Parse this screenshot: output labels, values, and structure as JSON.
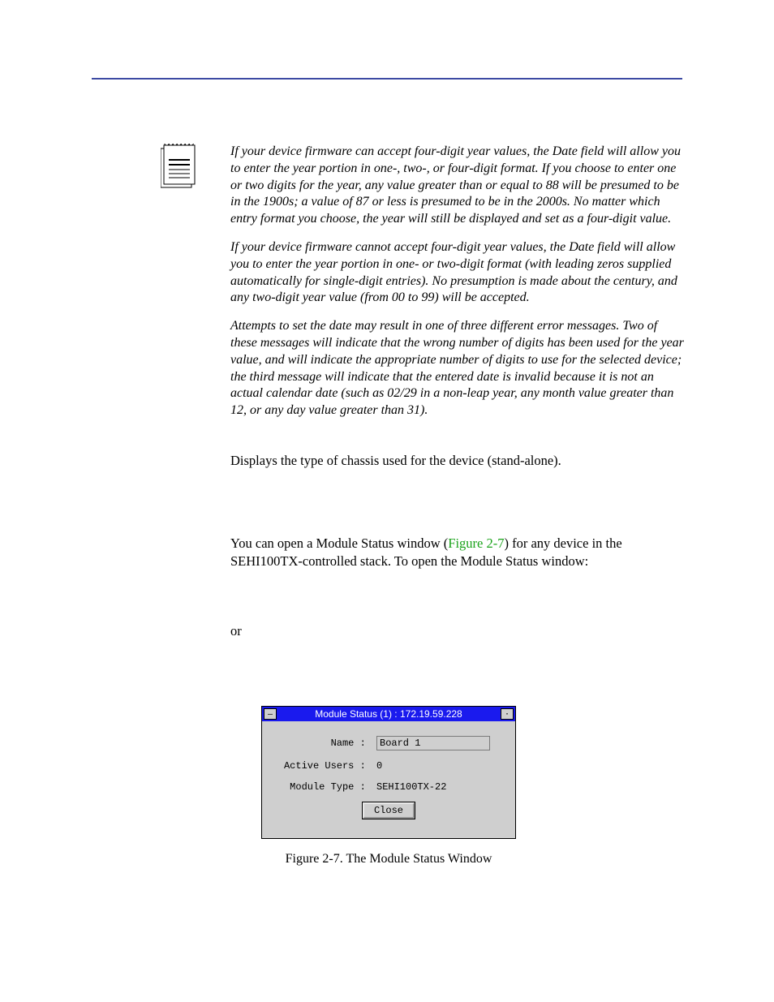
{
  "notes": {
    "p1": "If your device firmware can accept four-digit year values, the Date field will allow you to enter the year portion in one-, two-, or four-digit format. If you choose to enter one or two digits for the year, any value greater than or equal to 88 will be presumed to be in the 1900s; a value of 87 or less is presumed to be in the 2000s. No matter which entry format you choose, the year will still be displayed and set as a four-digit value.",
    "p2": "If your device firmware cannot accept four-digit year values, the Date field will allow you to enter the year portion in one- or two-digit format (with leading zeros supplied automatically for single-digit entries). No presumption is made about the century, and any two-digit year value (from 00 to 99) will be accepted.",
    "p3": "Attempts to set the date may result in one of three different error messages. Two of these messages will indicate that the wrong number of digits has been used for the year value, and will indicate the appropriate number of digits to use for the selected device; the third message will indicate that the entered date is invalid because it is not an actual calendar date (such as 02/29 in a non-leap year, any month value greater than 12, or any day value greater than 31)."
  },
  "chassis_text": "Displays the type of chassis used for the device (stand-alone).",
  "open_text_pre": "You can open a Module Status window (",
  "open_text_ref": "Figure 2-7",
  "open_text_post": ") for any device in the SEHI100TX-controlled stack. To open the Module Status window:",
  "or_text": "or",
  "window": {
    "title": "Module Status (1) : 172.19.59.228",
    "name_label": "Name : ",
    "name_value": "Board 1",
    "users_label": "Active Users : ",
    "users_value": "0",
    "type_label": "Module Type : ",
    "type_value": "SEHI100TX-22",
    "close": "Close"
  },
  "figure_caption": "Figure 2-7. The Module Status Window"
}
